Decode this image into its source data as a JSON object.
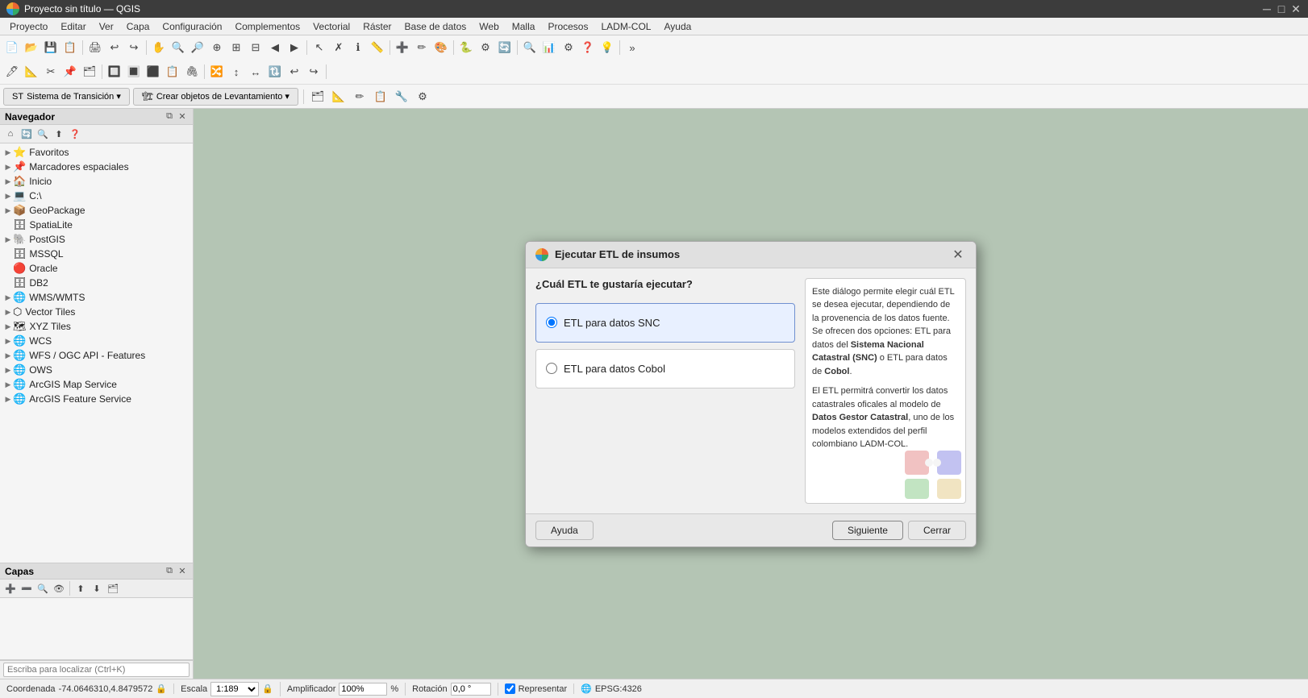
{
  "titlebar": {
    "title": "Proyecto sin título — QGIS",
    "min": "─",
    "max": "□",
    "close": "✕"
  },
  "menu": {
    "items": [
      "Proyecto",
      "Editar",
      "Ver",
      "Capa",
      "Configuración",
      "Complementos",
      "Vectorial",
      "Ráster",
      "Base de datos",
      "Web",
      "Malla",
      "Procesos",
      "LADM-COL",
      "Ayuda"
    ]
  },
  "left_panel": {
    "navigator_title": "Navegador",
    "tree_items": [
      {
        "label": "Favoritos",
        "icon": "⭐",
        "level": 0
      },
      {
        "label": "Marcadores espaciales",
        "icon": "📌",
        "level": 0
      },
      {
        "label": "Inicio",
        "icon": "🏠",
        "level": 0
      },
      {
        "label": "C:\\",
        "icon": "💻",
        "level": 0
      },
      {
        "label": "GeoPackage",
        "icon": "📦",
        "level": 0
      },
      {
        "label": "SpatiaLite",
        "icon": "🗄",
        "level": 0
      },
      {
        "label": "PostGIS",
        "icon": "🐘",
        "level": 0
      },
      {
        "label": "MSSQL",
        "icon": "🗄",
        "level": 0
      },
      {
        "label": "Oracle",
        "icon": "🔴",
        "level": 0
      },
      {
        "label": "DB2",
        "icon": "🗄",
        "level": 0
      },
      {
        "label": "WMS/WMTS",
        "icon": "🌐",
        "level": 0
      },
      {
        "label": "Vector Tiles",
        "icon": "⬡",
        "level": 0
      },
      {
        "label": "XYZ Tiles",
        "icon": "🗺",
        "level": 0
      },
      {
        "label": "WCS",
        "icon": "🌐",
        "level": 0
      },
      {
        "label": "WFS / OGC API - Features",
        "icon": "🌐",
        "level": 0
      },
      {
        "label": "OWS",
        "icon": "🌐",
        "level": 0
      },
      {
        "label": "ArcGIS Map Service",
        "icon": "🌐",
        "level": 0
      },
      {
        "label": "ArcGIS Feature Service",
        "icon": "🌐",
        "level": 0
      }
    ],
    "capas_title": "Capas",
    "search_placeholder": "Escriba para localizar (Ctrl+K)"
  },
  "dialog": {
    "title": "Ejecutar ETL de insumos",
    "close_label": "✕",
    "question": "¿Cuál ETL te gustaría ejecutar?",
    "options": [
      {
        "label": "ETL para datos SNC",
        "value": "snc",
        "selected": true
      },
      {
        "label": "ETL para datos Cobol",
        "value": "cobol",
        "selected": false
      }
    ],
    "description_parts": [
      {
        "text": "Este diálogo permite elegir cuál ETL se desea ejecutar, dependiendo de la provenencia de los datos fuente. Se ofrecen dos opciones: ETL para datos del "
      },
      {
        "text": "Sistema Nacional Catastral (SNC)",
        "bold": true
      },
      {
        "text": " o ETL para datos de "
      },
      {
        "text": "Cobol",
        "bold": true
      },
      {
        "text": "."
      },
      {
        "text": "\n\nEl ETL permitrá convertir los datos catastrales oficales al modelo de "
      },
      {
        "text": "Datos Gestor Catastral",
        "bold": true
      },
      {
        "text": ", uno de los modelos extendidos del perfil colombiano LADM-COL."
      }
    ],
    "buttons": {
      "help": "Ayuda",
      "next": "Siguiente",
      "close": "Cerrar"
    }
  },
  "statusbar": {
    "coord_label": "Coordenada",
    "coord_value": "-74.0646310,4.8479572",
    "scale_label": "Escala",
    "scale_value": "1:189",
    "magnifier_label": "Amplificador",
    "magnifier_value": "100%",
    "rotation_label": "Rotación",
    "rotation_value": "0,0 °",
    "render_label": "Representar",
    "epsg_label": "EPSG:4326"
  }
}
